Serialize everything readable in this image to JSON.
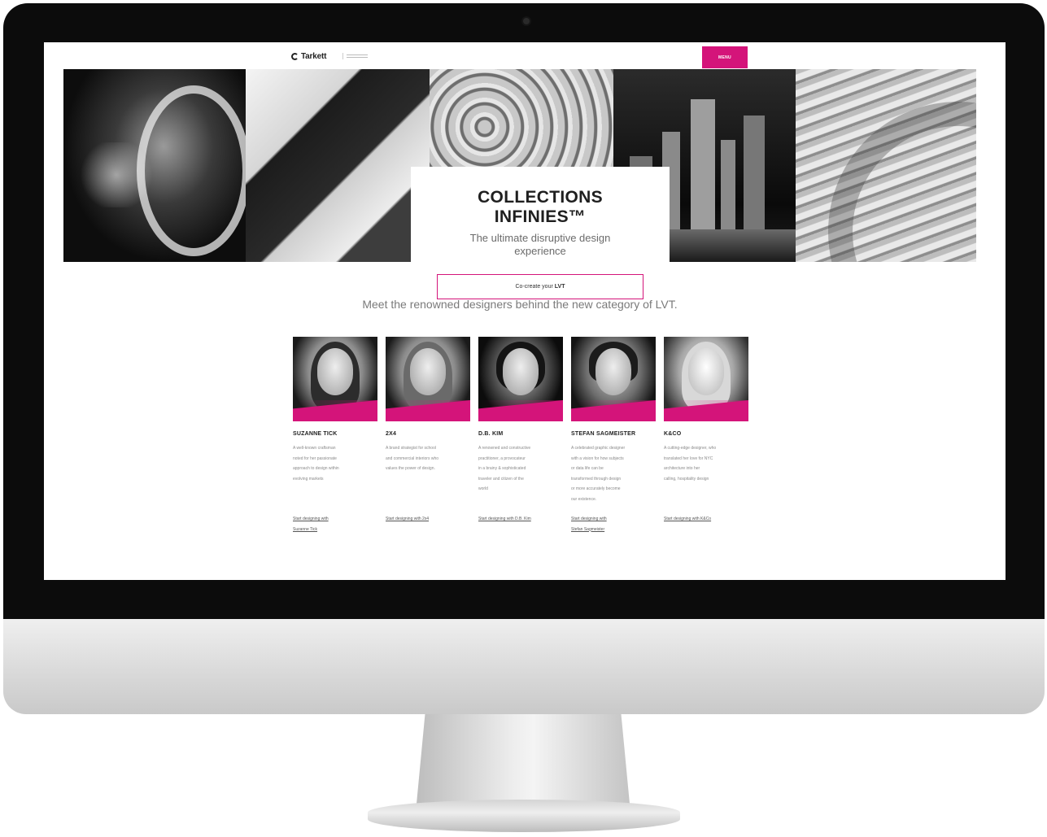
{
  "brand": {
    "name": "Tarkett"
  },
  "header": {
    "menu_label": "MENU"
  },
  "hero": {
    "title_line1": "COLLECTIONS",
    "title_line2": "INFINIES™",
    "subtitle_line1": "The ultimate disruptive design",
    "subtitle_line2": "experience",
    "cta_prefix": "Co-create your",
    "cta_strong": "LVT"
  },
  "intro": "Meet the renowned designers behind the new category of LVT.",
  "designers": [
    {
      "name": "SUZANNE TICK",
      "desc": [
        "A well-known craftsman",
        "noted for her passionate",
        "approach to design within",
        "evolving markets"
      ],
      "link": [
        "Start designing with",
        "Suzanne Tick"
      ]
    },
    {
      "name": "2X4",
      "desc": [
        "A brand strategist for school",
        "and commercial interiors who",
        "values the power of design."
      ],
      "link": [
        "Start designing with 2x4"
      ]
    },
    {
      "name": "D.B. KIM",
      "desc": [
        "A renowned and constructive",
        "practitioner, a provocateur",
        "in a brainy & sophisticated",
        "traveler and citizen of the",
        "world"
      ],
      "link": [
        "Start designing with D.B. Kim"
      ]
    },
    {
      "name": "STEFAN SAGMEISTER",
      "desc": [
        "A celebrated graphic designer",
        "with a vision for how subjects",
        "or data life can be",
        "transformed through design",
        "or more accurately become",
        "our existence."
      ],
      "link": [
        "Start designing with",
        "Stefan Sagmeister"
      ]
    },
    {
      "name": "K&CO",
      "desc": [
        "A cutting-edge designer, who",
        "translated her love for NYC",
        "architecture into her",
        "calling, hospitality design"
      ],
      "link": [
        "Start designing with K&Co"
      ]
    }
  ]
}
